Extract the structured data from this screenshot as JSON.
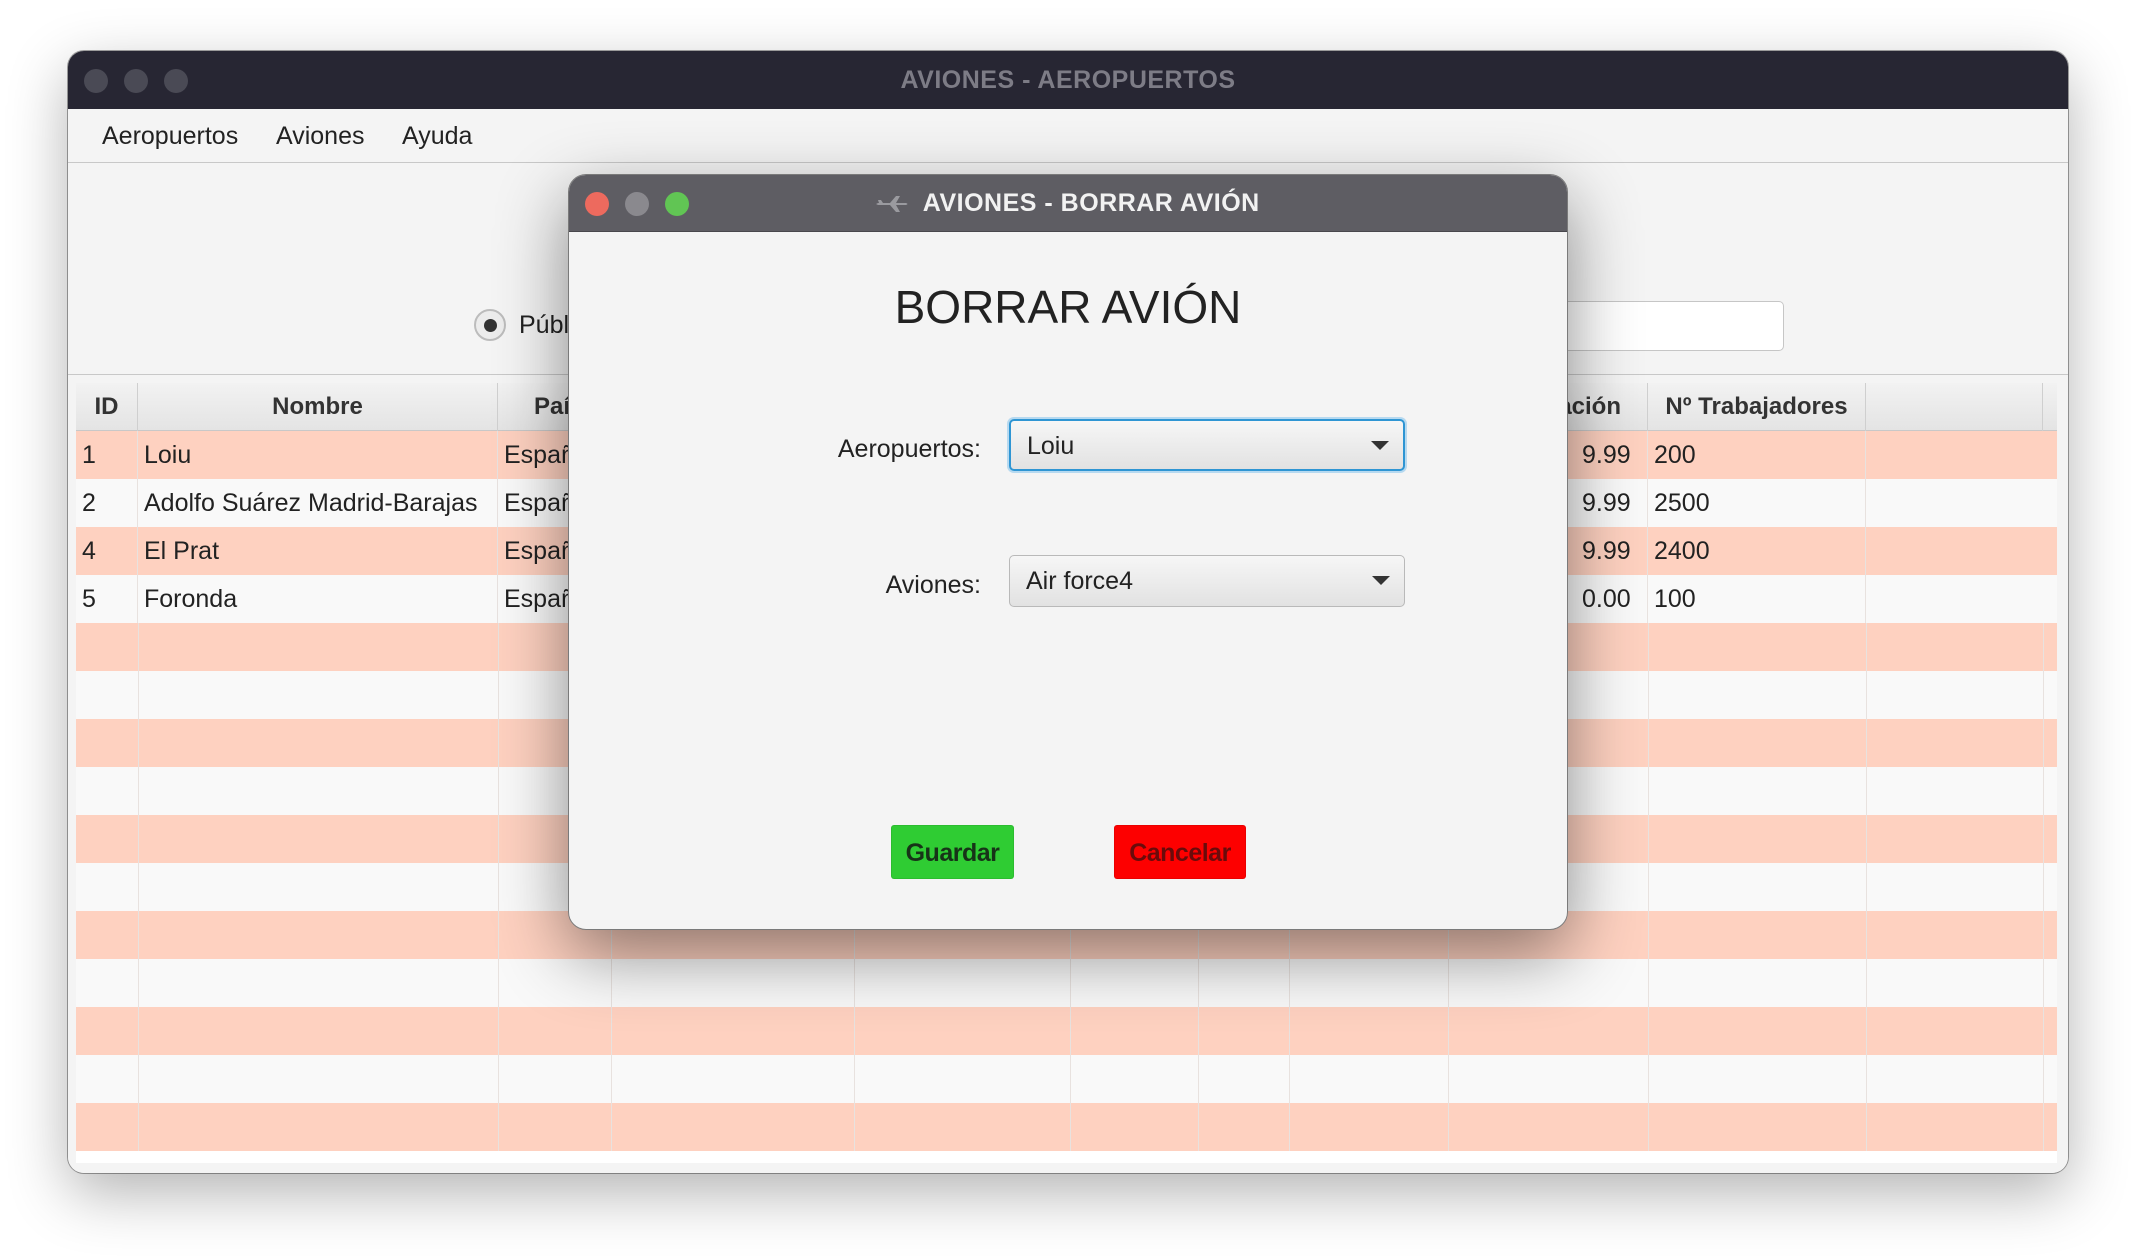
{
  "main_window": {
    "title": "AVIONES - AEROPUERTOS",
    "menu": [
      "Aeropuertos",
      "Aviones",
      "Ayuda"
    ],
    "radio_label": "Públ"
  },
  "table": {
    "headers": [
      "ID",
      "Nombre",
      "Paí",
      "",
      "",
      "",
      "",
      "",
      "ación",
      "Nº Trabajadores",
      ""
    ],
    "rows": [
      {
        "id": "1",
        "nombre": "Loiu",
        "pais": "Españ",
        "financiacion": "9.99",
        "trabajadores": "200"
      },
      {
        "id": "2",
        "nombre": "Adolfo Suárez Madrid-Barajas",
        "pais": "Españ",
        "financiacion": "9.99",
        "trabajadores": "2500"
      },
      {
        "id": "4",
        "nombre": "El Prat",
        "pais": "Españ",
        "financiacion": "9.99",
        "trabajadores": "2400"
      },
      {
        "id": "5",
        "nombre": "Foronda",
        "pais": "Españ",
        "financiacion": "0.00",
        "trabajadores": "100"
      }
    ]
  },
  "dialog": {
    "title": "AVIONES - BORRAR AVIÓN",
    "title_icon": "airplane-icon",
    "heading": "BORRAR AVIÓN",
    "aeropuertos_label": "Aeropuertos:",
    "aeropuertos_value": "Loiu",
    "aviones_label": "Aviones:",
    "aviones_value": "Air force4",
    "save_label": "Guardar",
    "cancel_label": "Cancelar"
  },
  "colors": {
    "row_highlight": "#fed1c0",
    "save_button": "#2fcc33",
    "cancel_button": "#fd0000",
    "focus_ring": "#2e95d3"
  }
}
